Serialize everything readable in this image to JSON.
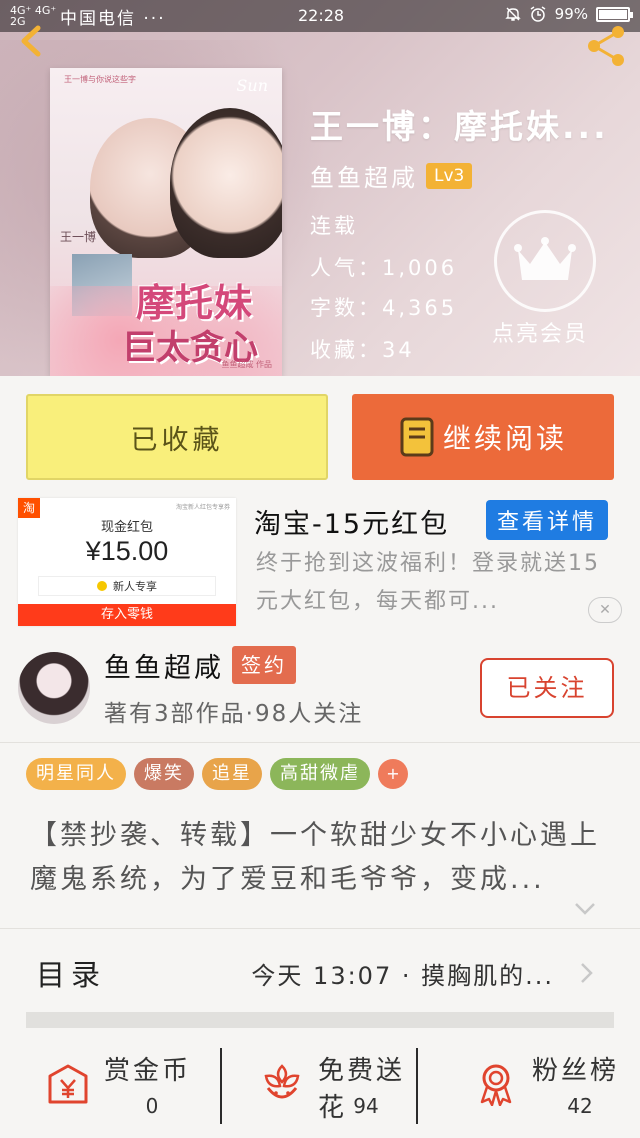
{
  "status_bar": {
    "signal": "4G⁺ 4G⁺\n2G",
    "carrier": "中国电信 ···",
    "time": "22:28",
    "battery": "99%"
  },
  "book": {
    "title": "王一博：摩托妹...",
    "author": "鱼鱼超咸",
    "level": "Lv3",
    "status": "连载",
    "popularity_label": "人气：",
    "popularity": "1,006",
    "words_label": "字数：",
    "words": "4,365",
    "favorites_label": "收藏：",
    "favorites": "34",
    "vip_label": "点亮会员"
  },
  "cover": {
    "top_text": "王一博与你说这些字",
    "signature": "Sun",
    "name_vertical": "王一博",
    "title_line1": "摩托妹",
    "title_line2": "巨太贪心",
    "author_credit": "鱼鱼超咸 作品"
  },
  "actions": {
    "collected_label": "已收藏",
    "continue_label": "继续阅读"
  },
  "ad": {
    "badge": "淘",
    "card_small": "淘宝新人红包专享券",
    "card_title": "现金红包",
    "amount": "¥15.00",
    "newbie": "新人专享",
    "deposit": "存入零钱",
    "title": "淘宝-15元红包",
    "detail_button": "查看详情",
    "description": "终于抢到这波福利！登录就送15元大红包，每天都可...",
    "close": "✕"
  },
  "author_card": {
    "name": "鱼鱼超咸",
    "badge": "签约",
    "stats": "著有3部作品·98人关注",
    "follow_button": "已关注"
  },
  "tags": [
    {
      "label": "明星同人",
      "color": "#f3b14a"
    },
    {
      "label": "爆笑",
      "color": "#c97a62"
    },
    {
      "label": "追星",
      "color": "#e8a44a"
    },
    {
      "label": "高甜微虐",
      "color": "#8cb65a"
    },
    {
      "label": "+",
      "color": "#ef7b5b"
    }
  ],
  "synopsis": "【禁抄袭、转载】一个软甜少女不小心遇上魔鬼系统，为了爱豆和毛爷爷，变成...",
  "toc": {
    "label": "目录",
    "latest": "今天 13:07 · 摸胸肌的..."
  },
  "bottom": [
    {
      "label": "赏金币",
      "value": "0",
      "icon": "reward-coin-icon"
    },
    {
      "label": "免费送花",
      "value": "94",
      "icon": "flower-icon"
    },
    {
      "label": "粉丝榜",
      "value": "42",
      "icon": "medal-icon"
    }
  ],
  "colors": {
    "accent_orange": "#ec6a3a",
    "collect_yellow": "#f9ef7b",
    "detail_blue": "#1f7ce2",
    "follow_red": "#d8432f"
  }
}
